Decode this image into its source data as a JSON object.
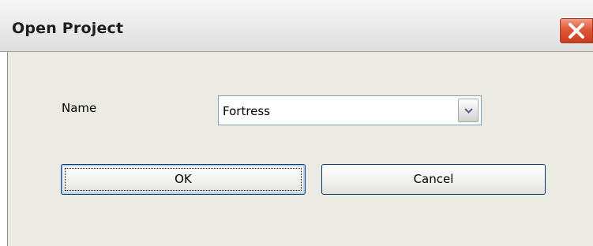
{
  "dialog": {
    "title": "Open Project"
  },
  "form": {
    "name_label": "Name",
    "project_value": "Fortress"
  },
  "buttons": {
    "ok_label": "OK",
    "cancel_label": "Cancel"
  },
  "icons": {
    "close": "close-icon",
    "dropdown": "chevron-down-icon"
  },
  "colors": {
    "close_button": "#e0573a",
    "window_background": "#ecebe3",
    "input_border": "#7f9db9"
  }
}
